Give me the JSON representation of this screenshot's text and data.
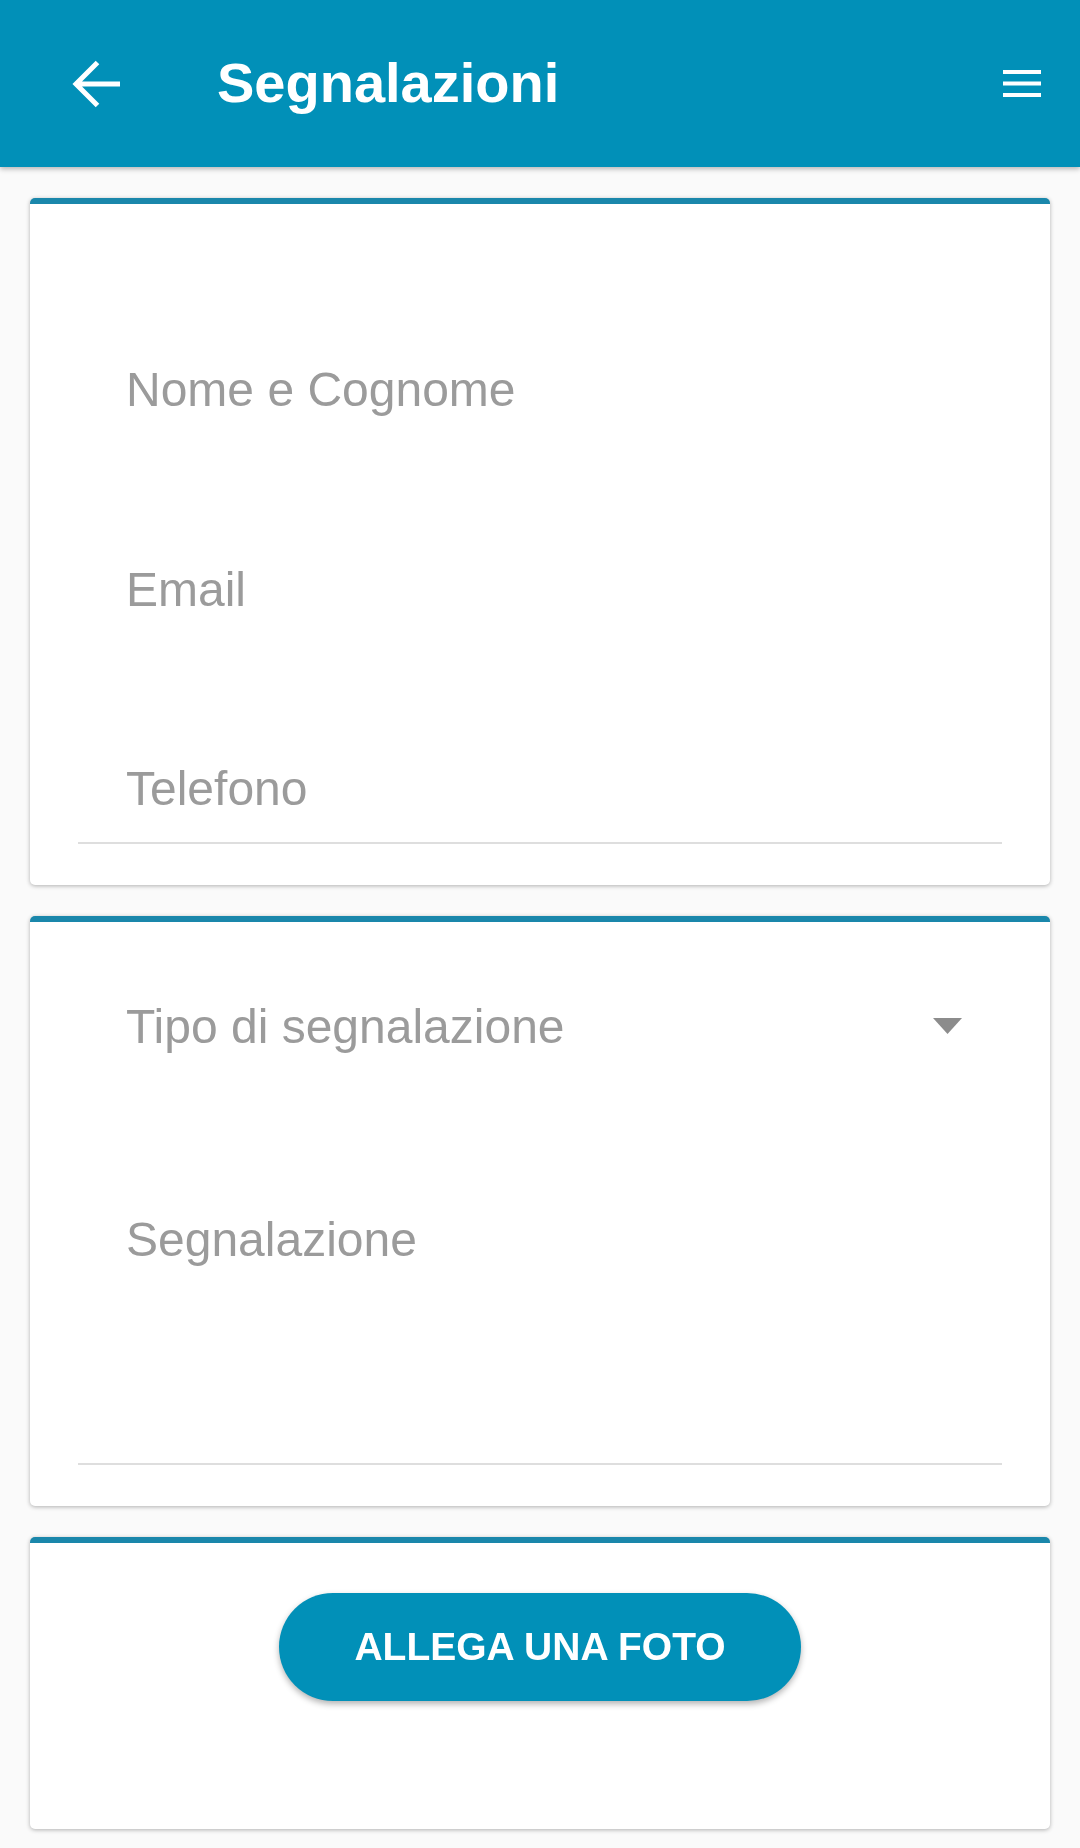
{
  "app_bar": {
    "title": "Segnalazioni"
  },
  "cards": [
    {
      "fields": [
        {
          "kind": "text",
          "placeholder": "Nome e Cognome",
          "underlined": false
        },
        {
          "kind": "text",
          "placeholder": "Email",
          "underlined": false
        },
        {
          "kind": "text",
          "placeholder": "Telefono",
          "underlined": true
        }
      ]
    },
    {
      "fields": [
        {
          "kind": "dropdown",
          "placeholder": "Tipo di segnalazione",
          "underlined": false
        },
        {
          "kind": "textarea",
          "placeholder": "Segnalazione",
          "underlined": true
        }
      ]
    },
    {
      "buttons": [
        {
          "label": "ALLEGA UNA FOTO"
        }
      ]
    }
  ]
}
